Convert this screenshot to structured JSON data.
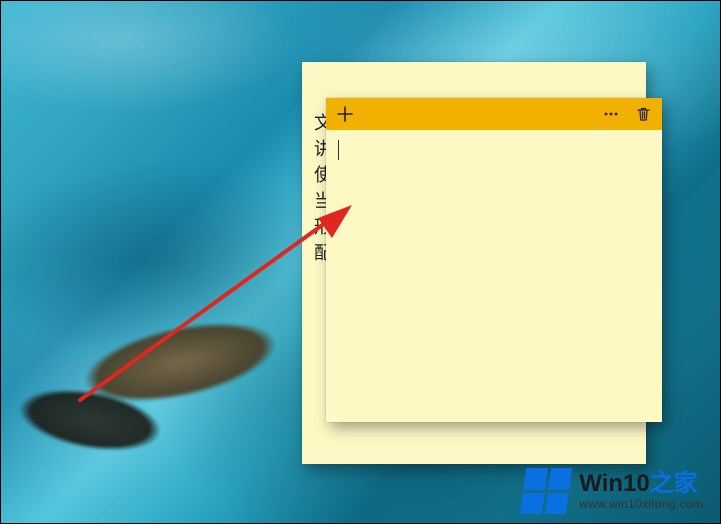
{
  "back_note": {
    "visible_text": "文\n讲\n使\n当\n形\n配"
  },
  "front_note": {
    "header": {
      "add_tooltip": "New note",
      "menu_tooltip": "Menu",
      "delete_tooltip": "Delete note"
    },
    "body": {
      "content": ""
    }
  },
  "watermark": {
    "brand_main": "Win10",
    "brand_suffix": "之家",
    "url": "www.win10xitong.com"
  },
  "colors": {
    "note_bg": "#fdf8c4",
    "note_header": "#f1b100",
    "arrow": "#e0261f",
    "brand_blue": "#0a6fe0"
  }
}
